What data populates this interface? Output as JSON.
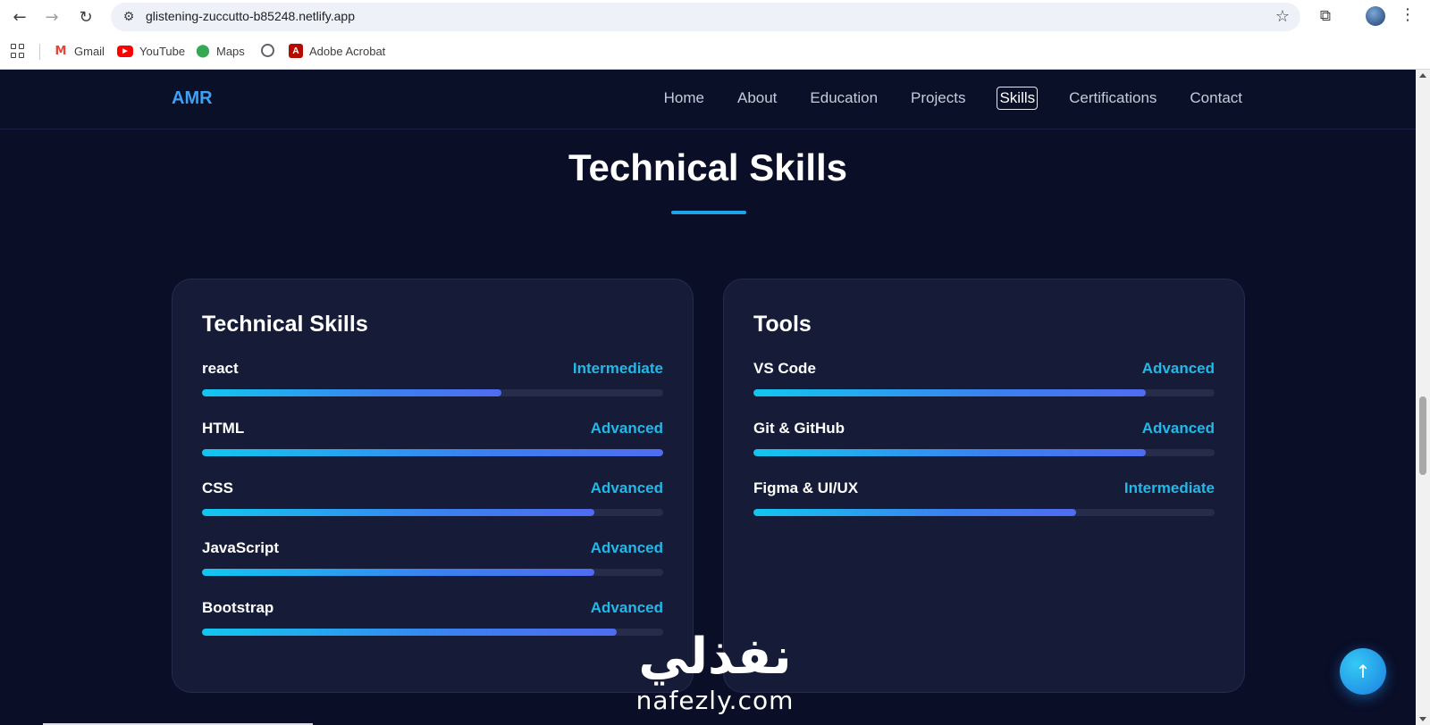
{
  "browser": {
    "url": "glistening-zuccutto-b85248.netlify.app",
    "nav": {
      "back_icon": "←",
      "forward_icon": "→",
      "reload_icon": "↻"
    },
    "bookmarks": [
      {
        "label": "Gmail",
        "icon": "gmail-icon"
      },
      {
        "label": "YouTube",
        "icon": "youtube-icon"
      },
      {
        "label": "Maps",
        "icon": "maps-icon"
      },
      {
        "label": "",
        "icon": "globe-icon"
      },
      {
        "label": "Adobe Acrobat",
        "icon": "acrobat-icon"
      }
    ]
  },
  "site": {
    "brand": "AMR",
    "nav": [
      "Home",
      "About",
      "Education",
      "Projects",
      "Skills",
      "Certifications",
      "Contact"
    ],
    "active_nav": "Skills",
    "section_title": "Technical Skills",
    "accent_color": "#1ea5e8",
    "cards": [
      {
        "title": "Technical Skills",
        "skills": [
          {
            "name": "react",
            "level": "Intermediate",
            "progress": 0.65
          },
          {
            "name": "HTML",
            "level": "Advanced",
            "progress": 1.0
          },
          {
            "name": "CSS",
            "level": "Advanced",
            "progress": 0.85
          },
          {
            "name": "JavaScript",
            "level": "Advanced",
            "progress": 0.85
          },
          {
            "name": "Bootstrap",
            "level": "Advanced",
            "progress": 0.9
          }
        ]
      },
      {
        "title": "Tools",
        "skills": [
          {
            "name": "VS Code",
            "level": "Advanced",
            "progress": 0.85
          },
          {
            "name": "Git & GitHub",
            "level": "Advanced",
            "progress": 0.85
          },
          {
            "name": "Figma & UI/UX",
            "level": "Intermediate",
            "progress": 0.7
          }
        ]
      }
    ]
  },
  "watermark": {
    "arabic": "نفذلي",
    "latin": "nafezly.com"
  }
}
